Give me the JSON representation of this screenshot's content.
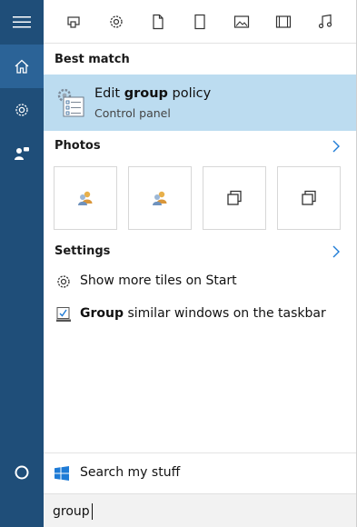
{
  "rail": {
    "menu_icon": "hamburger-icon",
    "items": [
      {
        "name": "home-icon",
        "active": true
      },
      {
        "name": "gear-icon",
        "active": false
      },
      {
        "name": "feedback-person-icon",
        "active": false
      }
    ],
    "cortana_icon": "cortana-circle-icon"
  },
  "filters": [
    "apps-icon",
    "settings-gear-icon",
    "document-icon",
    "folder-tablet-icon",
    "photo-icon",
    "video-icon",
    "music-icon"
  ],
  "best_match": {
    "header": "Best match",
    "title_prefix": "Edit ",
    "title_bold": "group",
    "title_suffix": " policy",
    "subtitle": "Control panel"
  },
  "photos": {
    "header": "Photos",
    "tiles": [
      "user-group-icon",
      "user-group-icon",
      "window-stack-icon",
      "window-stack-icon"
    ]
  },
  "settings": {
    "header": "Settings",
    "items": [
      {
        "icon": "gear-icon",
        "bold": "",
        "text": "Show more tiles on Start"
      },
      {
        "icon": "taskbar-icon",
        "bold": "Group",
        "text": " similar windows on the taskbar"
      }
    ]
  },
  "search_my_stuff": "Search my stuff",
  "search": {
    "value": "group"
  },
  "colors": {
    "rail": "#1f4e79",
    "rail_active": "#2b6397",
    "highlight": "#bcdcf0",
    "accent": "#1e7bd6"
  }
}
